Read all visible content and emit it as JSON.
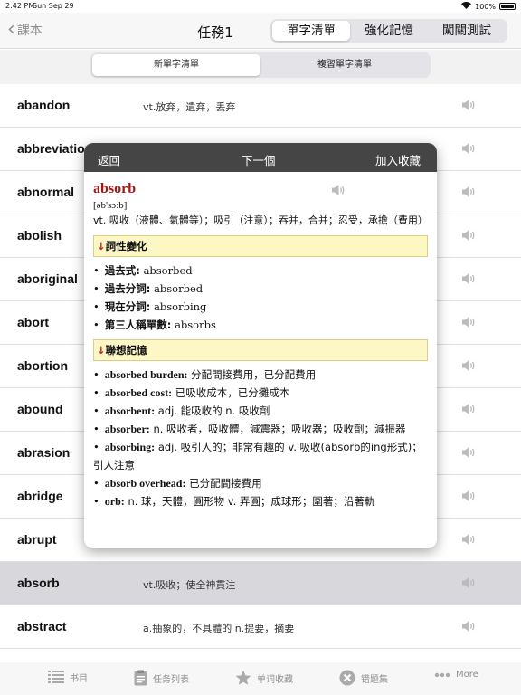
{
  "status": {
    "time": "2:42 PM",
    "date": "Sun Sep 29",
    "battery": "100%"
  },
  "nav": {
    "back_label": "課本",
    "title": "任務1",
    "segments": [
      "單字清單",
      "強化記憶",
      "闖關測試"
    ]
  },
  "subtabs": [
    "新單字清單",
    "複習單字清單"
  ],
  "words": [
    {
      "word": "abandon",
      "def": "vt.放弃，遺弃，丢弃"
    },
    {
      "word": "abbreviation",
      "def": ""
    },
    {
      "word": "abnormal",
      "def": ""
    },
    {
      "word": "abolish",
      "def": ""
    },
    {
      "word": "aboriginal",
      "def": ""
    },
    {
      "word": "abort",
      "def": ""
    },
    {
      "word": "abortion",
      "def": ""
    },
    {
      "word": "abound",
      "def": ""
    },
    {
      "word": "abrasion",
      "def": ""
    },
    {
      "word": "abridge",
      "def": ""
    },
    {
      "word": "abrupt",
      "def": ""
    },
    {
      "word": "absorb",
      "def": "vt.吸收；使全神貫注"
    },
    {
      "word": "abstract",
      "def": "a.抽象的，不具體的 n.提要，摘要"
    }
  ],
  "popup": {
    "back": "返回",
    "next": "下一個",
    "favorite": "加入收藏",
    "headword": "absorb",
    "phonetic": "[əb'sɔ:b]",
    "meaning": "vt. 吸收（液體、氣體等）；吸引（注意）；吞并，合并；忍受，承擔（費用）",
    "section1_title": "詞性變化",
    "forms": [
      {
        "label": "過去式:",
        "value": "absorbed"
      },
      {
        "label": "過去分詞:",
        "value": "absorbed"
      },
      {
        "label": "現在分詞:",
        "value": "absorbing"
      },
      {
        "label": "第三人稱單數:",
        "value": "absorbs"
      }
    ],
    "section2_title": "聯想記憶",
    "assoc": [
      {
        "term": "absorbed burden:",
        "text": "分配間接費用，已分配費用"
      },
      {
        "term": "absorbed cost:",
        "text": "已吸收成本，已分攤成本"
      },
      {
        "term": "absorbent:",
        "text": "adj. 能吸收的 n. 吸收劑"
      },
      {
        "term": "absorber:",
        "text": "n. 吸收者，吸收體，減震器；吸收器；吸收劑；減振器"
      },
      {
        "term": "absorbing:",
        "text": "adj. 吸引人的；非常有趣的 v. 吸收(absorb的ing形式)；引人注意"
      },
      {
        "term": "absorb overhead:",
        "text": "已分配間接費用"
      },
      {
        "term": "orb:",
        "text": "n. 球，天體，圓形物 v. 弄圓；成球形；圍著；沿著軌"
      }
    ]
  },
  "tabbar": [
    {
      "label": "书目",
      "icon": "list-icon"
    },
    {
      "label": "任务列表",
      "icon": "clipboard-icon"
    },
    {
      "label": "单词收藏",
      "icon": "star-icon"
    },
    {
      "label": "错题集",
      "icon": "x-circle-icon"
    },
    {
      "label": "More",
      "icon": "more-icon"
    }
  ]
}
